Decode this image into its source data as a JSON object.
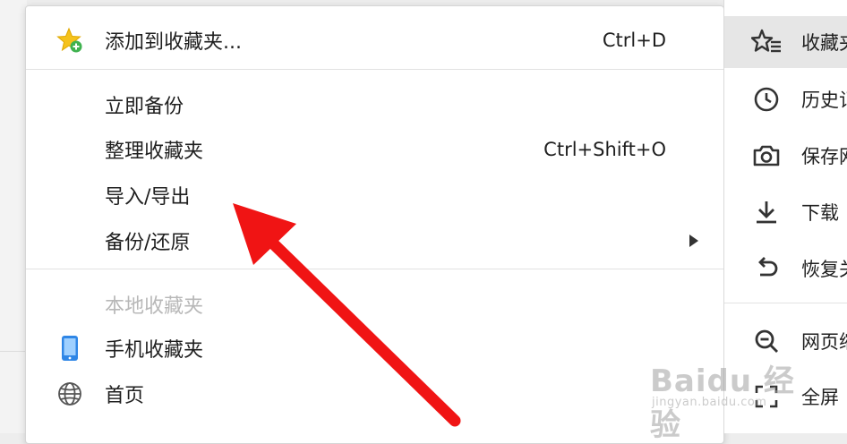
{
  "bookmarks_menu": {
    "add_to_bookmarks": {
      "label": "添加到收藏夹...",
      "shortcut": "Ctrl+D",
      "icon": "star-add-icon"
    },
    "backup_now": {
      "label": "立即备份"
    },
    "organize_bookmarks": {
      "label": "整理收藏夹",
      "shortcut": "Ctrl+Shift+O"
    },
    "import_export": {
      "label": "导入/导出"
    },
    "backup_restore": {
      "label": "备份/还原"
    },
    "local_bookmarks": {
      "label": "本地收藏夹"
    },
    "mobile_bookmarks": {
      "label": "手机收藏夹",
      "icon": "phone-icon"
    },
    "home": {
      "label": "首页",
      "icon": "globe-icon"
    }
  },
  "main_menu": {
    "items": [
      {
        "label": "收藏夹",
        "icon": "star-list-icon",
        "active": true
      },
      {
        "label": "历史记",
        "icon": "clock-icon"
      },
      {
        "label": "保存网",
        "icon": "camera-icon"
      },
      {
        "label": "下载",
        "icon": "download-icon"
      },
      {
        "label": "恢复关",
        "icon": "undo-icon"
      },
      {
        "label": "网页缩",
        "icon": "zoom-out-icon"
      },
      {
        "label": "全屏",
        "icon": "fullscreen-icon"
      }
    ]
  },
  "watermark": {
    "logo": "Baidu 经验",
    "sub": "jingyan.baidu.com"
  },
  "colors": {
    "annotation_arrow": "#f01414",
    "star_icon": "#f5c21b",
    "star_plus": "#3fb24f",
    "phone_icon": "#2f86e6"
  }
}
